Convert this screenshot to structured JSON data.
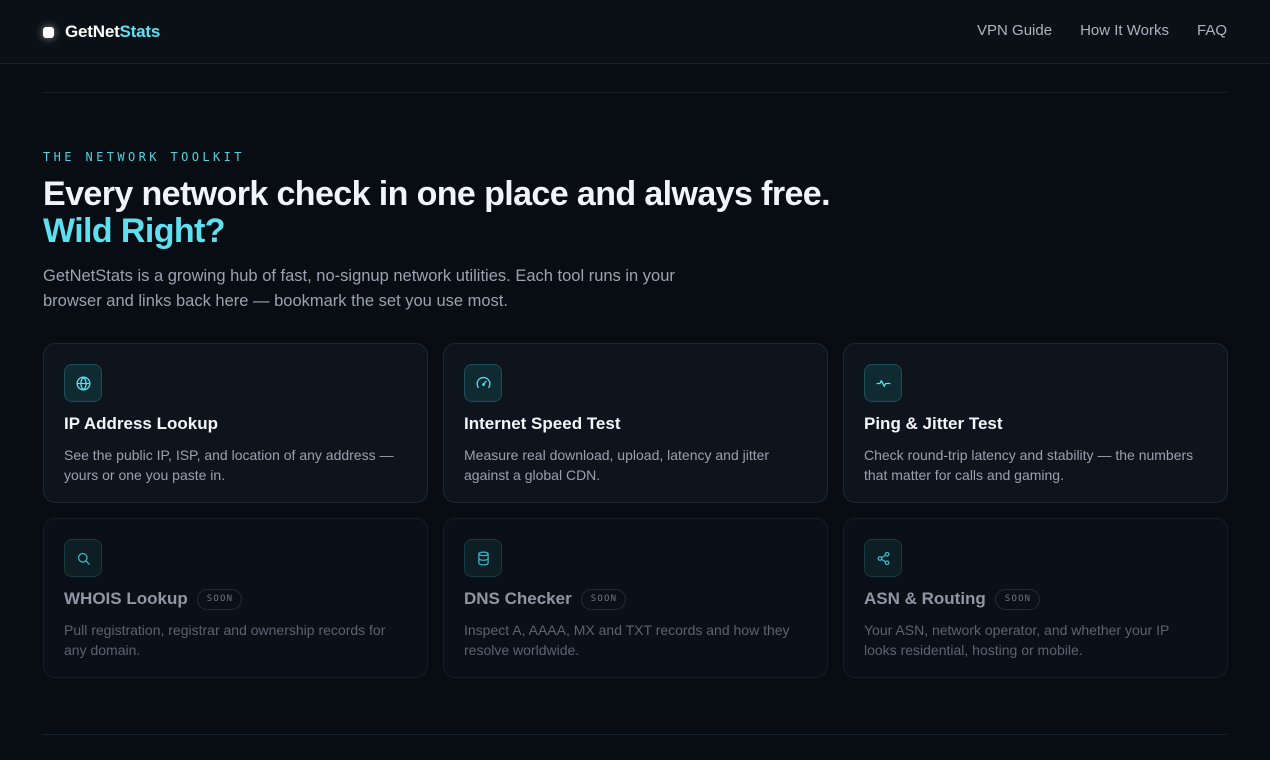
{
  "brand": {
    "name_main": "GetNet",
    "name_accent": "Stats"
  },
  "nav": {
    "items": [
      {
        "label": "VPN Guide"
      },
      {
        "label": "How It Works"
      },
      {
        "label": "FAQ"
      }
    ]
  },
  "hero": {
    "eyebrow": "THE NETWORK TOOLKIT",
    "headline": "Every network check in one place and always free.",
    "headline_accent": "Wild Right?",
    "intro": "GetNetStats is a growing hub of fast, no-signup network utilities. Each tool runs in your browser and links back here — bookmark the set you use most."
  },
  "tools": [
    {
      "icon": "globe-icon",
      "title": "IP Address Lookup",
      "description": "See the public IP, ISP, and location of any address — yours or one you paste in.",
      "badge": ""
    },
    {
      "icon": "speedometer-icon",
      "title": "Internet Speed Test",
      "description": "Measure real download, upload, latency and jitter against a global CDN.",
      "badge": ""
    },
    {
      "icon": "pulse-icon",
      "title": "Ping & Jitter Test",
      "description": "Check round-trip latency and stability — the numbers that matter for calls and gaming.",
      "badge": ""
    },
    {
      "icon": "search-icon",
      "title": "WHOIS Lookup",
      "description": "Pull registration, registrar and ownership records for any domain.",
      "badge": "SOON"
    },
    {
      "icon": "database-icon",
      "title": "DNS Checker",
      "description": "Inspect A, AAAA, MX and TXT records and how they resolve worldwide.",
      "badge": "SOON"
    },
    {
      "icon": "share-nodes-icon",
      "title": "ASN & Routing",
      "description": "Your ASN, network operator, and whether your IP looks residential, hosting or mobile.",
      "badge": "SOON"
    }
  ],
  "colors": {
    "background": "#080c13",
    "accent": "#5ee0f0",
    "card": "#0e141c"
  }
}
